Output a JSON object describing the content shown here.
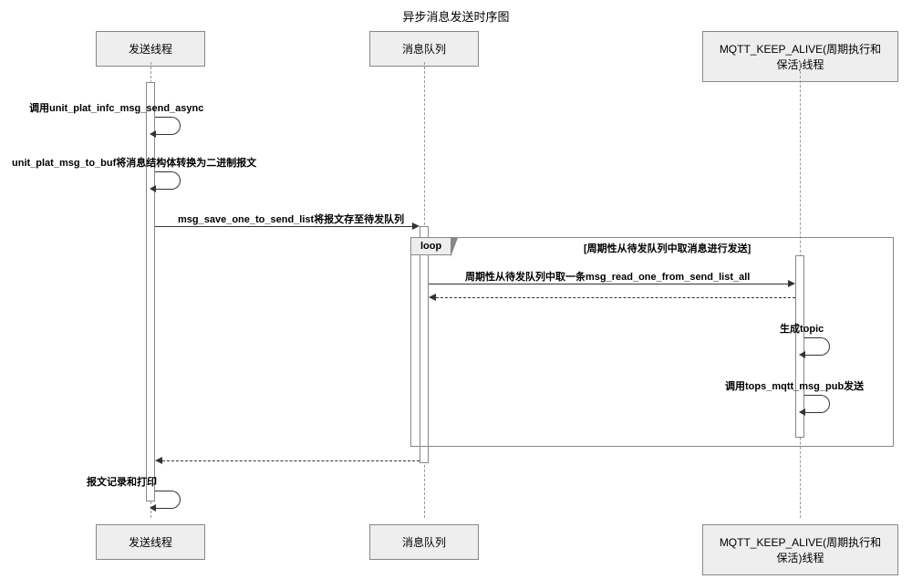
{
  "title": "异步消息发送时序图",
  "participants": {
    "p1": "发送线程",
    "p2": "消息队列",
    "p3": "MQTT_KEEP_ALIVE(周期执行和保活)线程"
  },
  "messages": {
    "m1": "调用unit_plat_infc_msg_send_async",
    "m2": "unit_plat_msg_to_buf将消息结构体转换为二进制报文",
    "m3": "msg_save_one_to_send_list将报文存至待发队列",
    "m4": "周期性从待发队列中取一条msg_read_one_from_send_list_all",
    "m5": "生成topic",
    "m6": "调用tops_mqtt_msg_pub发送",
    "m7": "报文记录和打印"
  },
  "loop": {
    "tag": "loop",
    "condition": "[周期性从待发队列中取消息进行发送]"
  }
}
